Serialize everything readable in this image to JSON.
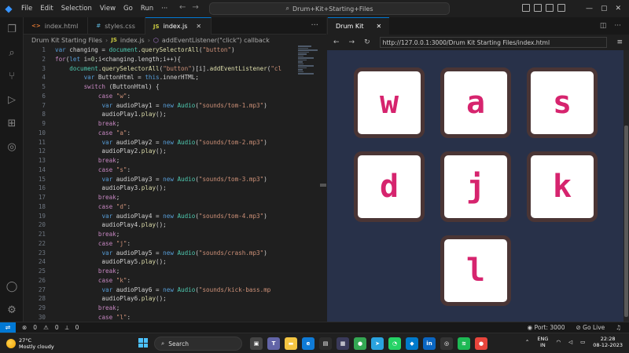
{
  "titlebar": {
    "menu": [
      "File",
      "Edit",
      "Selection",
      "View",
      "Go",
      "Run",
      "···"
    ],
    "command_center": "Drum+Kit+Starting+Files",
    "window_controls": [
      "—",
      "▢",
      "✕"
    ]
  },
  "tabs": [
    {
      "icon": "<>",
      "label": "index.html",
      "active": false
    },
    {
      "icon": "#",
      "label": "styles.css",
      "active": false
    },
    {
      "icon": "JS",
      "label": "index.js",
      "active": true
    }
  ],
  "breadcrumb": {
    "folder": "Drum Kit Starting Files",
    "file": "index.js",
    "symbol": "addEventListener(\"click\") callback"
  },
  "code_lines": [
    {
      "n": "1",
      "text": "var changing = document.querySelectorAll(\"button\")"
    },
    {
      "n": "2",
      "text": "for(let i=0;i<changing.length;i++){"
    },
    {
      "n": "3",
      "text": "    document.querySelectorAll(\"button\")[i].addEventListener(\"cl"
    },
    {
      "n": "4",
      "text": "        var ButtonHtml = this.innerHTML;"
    },
    {
      "n": "5",
      "text": "        switch (ButtonHtml) {"
    },
    {
      "n": "6",
      "text": "            case \"w\":"
    },
    {
      "n": "7",
      "text": "             var audioPlay1 = new Audio(\"sounds/tom-1.mp3\")"
    },
    {
      "n": "8",
      "text": "             audioPlay1.play();"
    },
    {
      "n": "9",
      "text": "            break;"
    },
    {
      "n": "10",
      "text": "            case \"a\":"
    },
    {
      "n": "11",
      "text": "             var audioPlay2 = new Audio(\"sounds/tom-2.mp3\")"
    },
    {
      "n": "12",
      "text": "             audioPlay2.play();"
    },
    {
      "n": "13",
      "text": "            break;"
    },
    {
      "n": "14",
      "text": "            case \"s\":"
    },
    {
      "n": "15",
      "text": "             var audioPlay3 = new Audio(\"sounds/tom-3.mp3\")"
    },
    {
      "n": "16",
      "text": "             audioPlay3.play();"
    },
    {
      "n": "17",
      "text": "            break;"
    },
    {
      "n": "18",
      "text": "            case \"d\":"
    },
    {
      "n": "19",
      "text": "             var audioPlay4 = new Audio(\"sounds/tom-4.mp3\")"
    },
    {
      "n": "20",
      "text": "             audioPlay4.play();"
    },
    {
      "n": "21",
      "text": "            break;"
    },
    {
      "n": "22",
      "text": "            case \"j\":"
    },
    {
      "n": "23",
      "text": "             var audioPlay5 = new Audio(\"sounds/crash.mp3\")"
    },
    {
      "n": "24",
      "text": "             audioPlay5.play();"
    },
    {
      "n": "25",
      "text": "            break;"
    },
    {
      "n": "26",
      "text": "            case \"k\":"
    },
    {
      "n": "27",
      "text": "             var audioPlay6 = new Audio(\"sounds/kick-bass.mp"
    },
    {
      "n": "28",
      "text": "             audioPlay6.play();"
    },
    {
      "n": "29",
      "text": "            break;"
    },
    {
      "n": "30",
      "text": "            case \"l\":"
    }
  ],
  "browser": {
    "tab_title": "Drum Kit",
    "url": "http://127.0.0.1:3000/Drum Kit Starting Files/index.html",
    "background": "#283149",
    "drums": [
      "w",
      "a",
      "s",
      "d",
      "j",
      "k",
      "l"
    ]
  },
  "statusbar": {
    "errors": "0",
    "warnings": "0",
    "ports": "0",
    "port": "Port: 3000",
    "golive": "Go Live"
  },
  "taskbar": {
    "temp": "27°C",
    "weather": "Mostly cloudy",
    "search_placeholder": "Search",
    "lang_top": "ENG",
    "lang_bottom": "IN",
    "time": "22:28",
    "date": "08-12-2023",
    "notification_count": "1"
  },
  "colors": {
    "accent": "#0078d4",
    "drum_text": "#d6246e",
    "drum_border": "#4a3535"
  }
}
